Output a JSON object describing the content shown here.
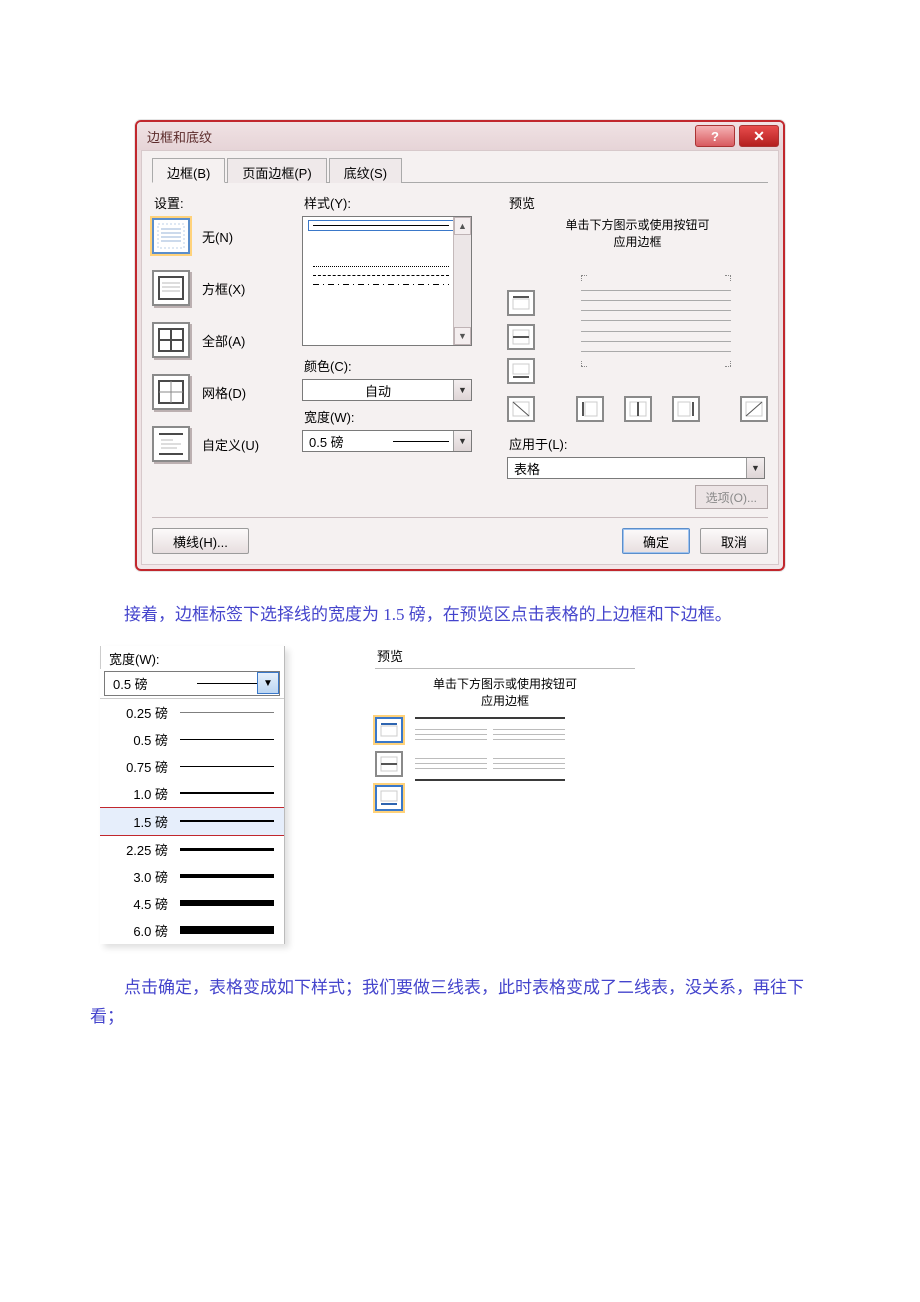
{
  "dialog": {
    "title": "边框和底纹",
    "tabs": {
      "borders": "边框(B)",
      "page_borders": "页面边框(P)",
      "shading": "底纹(S)"
    },
    "settings_label": "设置:",
    "settings": {
      "none": "无(N)",
      "box": "方框(X)",
      "all": "全部(A)",
      "grid": "网格(D)",
      "custom": "自定义(U)"
    },
    "style_label": "样式(Y):",
    "color_label": "颜色(C):",
    "color_value": "自动",
    "width_label": "宽度(W):",
    "width_value": "0.5 磅",
    "preview_label": "预览",
    "preview_hint1": "单击下方图示或使用按钮可",
    "preview_hint2": "应用边框",
    "apply_to_label": "应用于(L):",
    "apply_to_value": "表格",
    "options_btn": "选项(O)...",
    "hline_btn": "横线(H)...",
    "ok": "确定",
    "cancel": "取消"
  },
  "para1": "接着，边框标签下选择线的宽度为 1.5 磅，在预览区点击表格的上边框和下边框。",
  "width_dropdown": {
    "label": "宽度(W):",
    "current": "0.5 磅",
    "options": [
      "0.25 磅",
      "0.5 磅",
      "0.75 磅",
      "1.0 磅",
      "1.5 磅",
      "2.25 磅",
      "3.0 磅",
      "4.5 磅",
      "6.0 磅"
    ]
  },
  "preview2": {
    "label": "预览",
    "hint1": "单击下方图示或使用按钮可",
    "hint2": "应用边框"
  },
  "para2": "点击确定，表格变成如下样式；我们要做三线表，此时表格变成了二线表，没关系，再往下看；"
}
